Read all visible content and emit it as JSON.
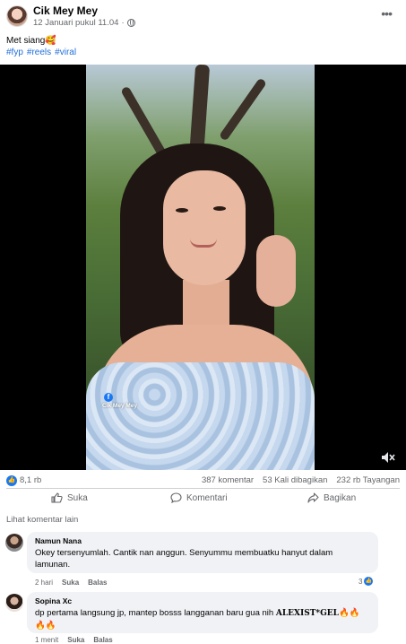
{
  "post": {
    "author": "Cik Mey Mey",
    "date": "12 Januari pukul 11.04",
    "date_sep": "·",
    "more_glyph": "•••",
    "caption": "Met siang🥰",
    "hashtags": [
      "#fyp",
      "#reels",
      "#viral"
    ]
  },
  "video": {
    "watermark_name": "Cik Mey Mey",
    "watermark_icon": "f"
  },
  "stats": {
    "likes": "8,1 rb",
    "comments": "387 komentar",
    "shares": "53 Kali dibagikan",
    "views": "232 rb Tayangan"
  },
  "actions": {
    "like": "Suka",
    "comment": "Komentari",
    "share": "Bagikan"
  },
  "comments_section": {
    "more_label": "Lihat komentar lain",
    "items": [
      {
        "name": "Namun Nana",
        "text_line1": "Okey tersenyumlah. Cantik nan anggun. Senyummu membuatku hanyut dalam",
        "text_line2": "lamunan.",
        "time": "2 hari",
        "like": "Suka",
        "reply": "Balas",
        "reactions": "3"
      },
      {
        "name": "Sopina Xc",
        "text_prefix": "dp pertama langsung jp, mantep bosss langganan baru gua nih ",
        "text_bold": "ALEXIST*GEL",
        "text_emoji1": "🔥🔥",
        "text_emoji2": "🔥🔥",
        "time": "1 menit",
        "like": "Suka",
        "reply": "Balas"
      }
    ]
  },
  "colors": {
    "link": "#216fdb",
    "accent": "#1877f2",
    "muted": "#65676b",
    "bubble": "#f0f2f5"
  },
  "icons": [
    "globe-icon",
    "more-icon",
    "like-icon",
    "comment-icon",
    "share-icon",
    "mute-icon",
    "facebook-icon"
  ]
}
